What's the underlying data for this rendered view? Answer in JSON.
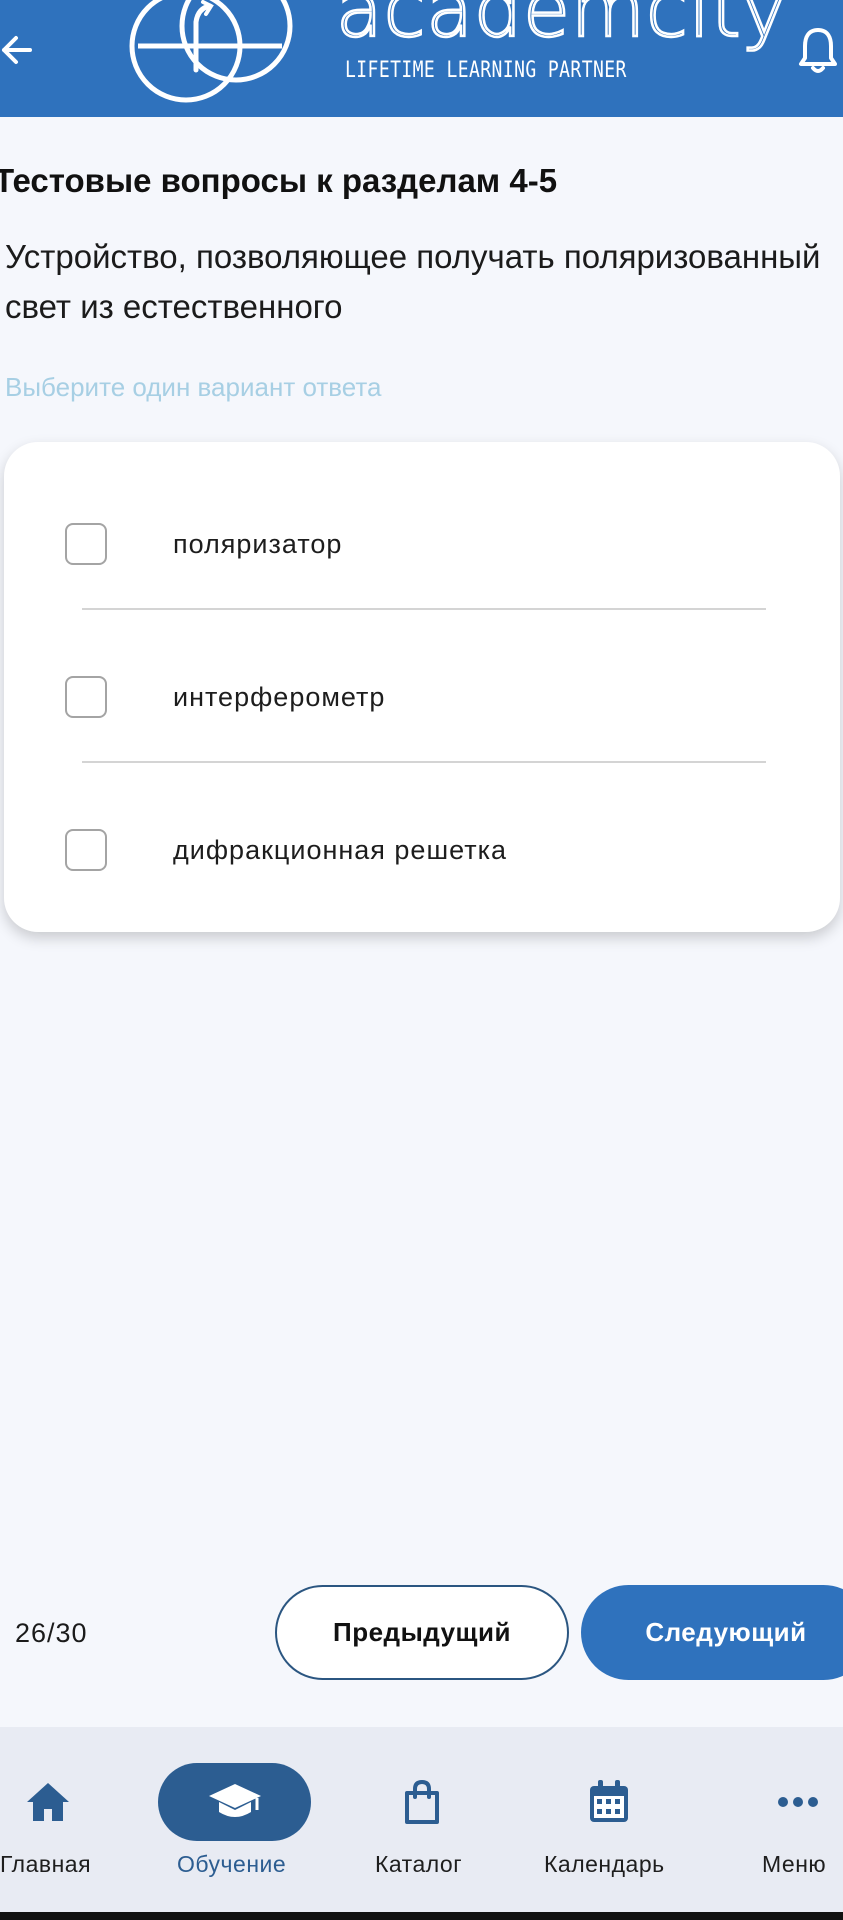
{
  "header": {
    "brand": "academcity",
    "tagline": "LIFETIME LEARNING PARTNER",
    "back_icon": "arrow-left-icon",
    "notification_icon": "bell-icon",
    "color": "#2f72bd"
  },
  "quiz": {
    "section_title": "Тестовые вопросы к разделам 4-5",
    "question": "Устройство, позволяющее получать поляризованный свет из естественного",
    "hint": "Выберите один вариант ответа",
    "options": [
      {
        "label": "поляризатор",
        "checked": false
      },
      {
        "label": "интерферометр",
        "checked": false
      },
      {
        "label": "дифракционная решетка",
        "checked": false
      }
    ]
  },
  "pagination": {
    "counter": "26/30",
    "prev_label": "Предыдущий",
    "next_label": "Следующий"
  },
  "nav": {
    "active": "learning",
    "items": [
      {
        "id": "home",
        "label": "Главная",
        "icon": "home-icon"
      },
      {
        "id": "learning",
        "label": "Обучение",
        "icon": "graduation-cap-icon"
      },
      {
        "id": "catalog",
        "label": "Каталог",
        "icon": "shopping-bag-icon"
      },
      {
        "id": "calendar",
        "label": "Календарь",
        "icon": "calendar-icon"
      },
      {
        "id": "menu",
        "label": "Меню",
        "icon": "more-horizontal-icon"
      }
    ]
  }
}
